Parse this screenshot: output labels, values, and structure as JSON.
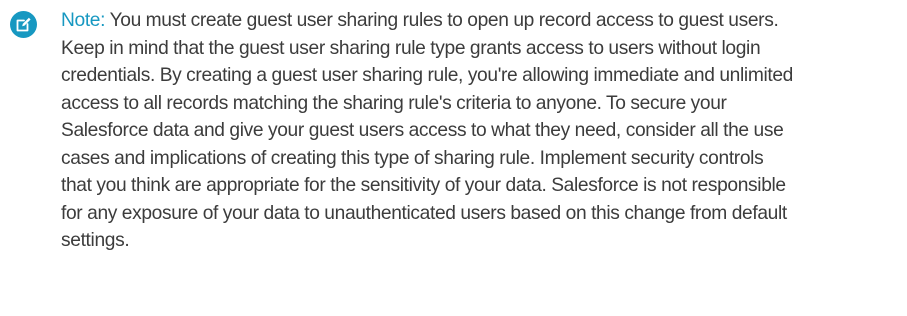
{
  "note": {
    "icon": "edit-note-icon",
    "label": "Note:",
    "lines": [
      "You must create guest user sharing rules to open up record access to guest users.",
      "Keep in mind that the guest user sharing rule type grants access to users without login",
      "credentials. By creating a guest user sharing rule, you're allowing immediate and unlimited",
      "access to all records matching the sharing rule's criteria to anyone. To secure your",
      "Salesforce data and give your guest users access to what they need, consider all the use",
      "cases and implications of creating this type of sharing rule. Implement security controls",
      "that you think are appropriate for the sensitivity of your data. Salesforce is not responsible",
      "for any exposure of your data to unauthenticated users based on this change from default",
      "settings."
    ]
  },
  "colors": {
    "accent": "#1798c1",
    "icon_background": "#1798c1",
    "text": "#3c3c3c"
  }
}
